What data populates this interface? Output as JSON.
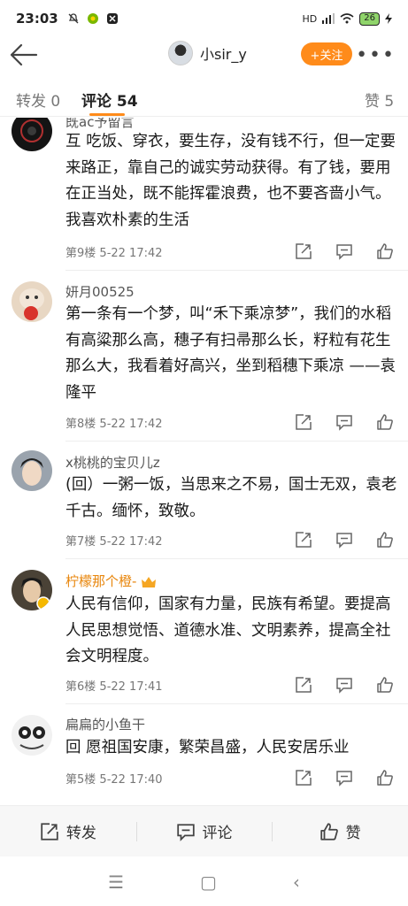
{
  "status_bar": {
    "time": "23:03",
    "battery": "26",
    "network": "HD"
  },
  "header": {
    "username": "小sir_y",
    "follow_label": "+关注",
    "more_label": "•••"
  },
  "tabs": [
    {
      "label": "转发 0"
    },
    {
      "label": "评论 54"
    },
    {
      "label": "赞 5"
    }
  ],
  "comments": [
    {
      "name": "既ac予留言",
      "text": "互 吃饭、穿衣，要生存，没有钱不行，但一定要来路正，靠自己的诚实劳动获得。有了钱，要用在正当处，既不能挥霍浪费，也不要吝啬小气。我喜欢朴素的生活",
      "floor": "第9楼",
      "time": "5-22 17:42"
    },
    {
      "name": "妍月00525",
      "text": "第一条有一个梦，叫“禾下乘凉梦”，我们的水稻有高粱那么高，穗子有扫帚那么长，籽粒有花生那么大，我看着好高兴，坐到稻穗下乘凉 ——袁隆平",
      "floor": "第8楼",
      "time": "5-22 17:42"
    },
    {
      "name": "x桃桃的宝贝儿z",
      "text": "(回）一粥一饭，当思来之不易，国士无双，袁老千古。缅怀，致敬。",
      "floor": "第7楼",
      "time": "5-22 17:42"
    },
    {
      "name": "柠檬那个橙-",
      "text": "人民有信仰，国家有力量，民族有希望。要提高人民思想觉悟、道德水准、文明素养，提高全社会文明程度。",
      "floor": "第6楼",
      "time": "5-22 17:41"
    },
    {
      "name": "扁扁的小鱼干",
      "text": "回  愿祖国安康，繁荣昌盛，人民安居乐业",
      "floor": "第5楼",
      "time": "5-22 17:40"
    }
  ],
  "bottom_bar": {
    "repost": "转发",
    "comment": "评论",
    "like": "赞"
  },
  "nav": {
    "menu": "☰",
    "home": "▢",
    "back": "‹"
  },
  "colors": {
    "accent": "#ff8b1a",
    "vip_name": "#e8860c"
  }
}
